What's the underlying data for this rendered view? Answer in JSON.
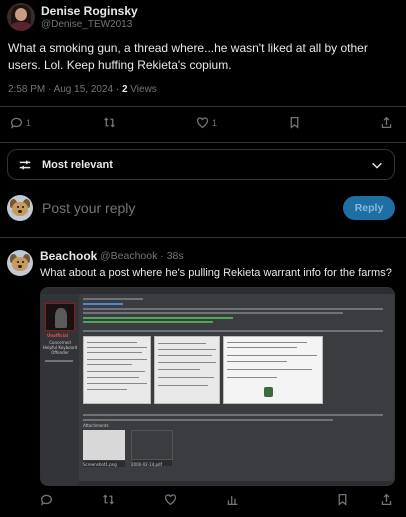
{
  "main_post": {
    "author_name": "Denise Roginsky",
    "author_handle": "@Denise_TEW2013",
    "text": "What a smoking gun, a thread where...he wasn't liked at all by other users. Lol. Keep huffing Rekieta's copium.",
    "time": "2:58 PM · Aug 15, 2024 · ",
    "views_count": "2",
    "views_label": " Views",
    "stats": {
      "replies": "1",
      "reposts": "",
      "likes": "1"
    }
  },
  "sort": {
    "label": "Most relevant"
  },
  "composer": {
    "placeholder": "Post your reply",
    "reply_button": "Reply"
  },
  "reply": {
    "author_name": "Beachook",
    "author_handle": "@Beachook · 38s",
    "text": "What about a post where he's pulling Rekieta warrant info for the farms?",
    "embedded_screenshot": {
      "user_title": "Unofficial",
      "user_sub": "Concerned Helpful Keyboard Offender",
      "attachments_label": "Attachments",
      "file1": "Screenshot1.png",
      "file2": "2000-02-14.pdf"
    }
  },
  "colors": {
    "background": "#000000",
    "text": "#e7e9ea",
    "muted": "#71767b",
    "divider": "#2f3336",
    "reply_button": "#1d6fa5"
  },
  "icons": [
    "reply-icon",
    "repost-icon",
    "like-icon",
    "bookmark-icon",
    "share-icon",
    "views-icon",
    "sort-icon",
    "chevron-down-icon"
  ]
}
